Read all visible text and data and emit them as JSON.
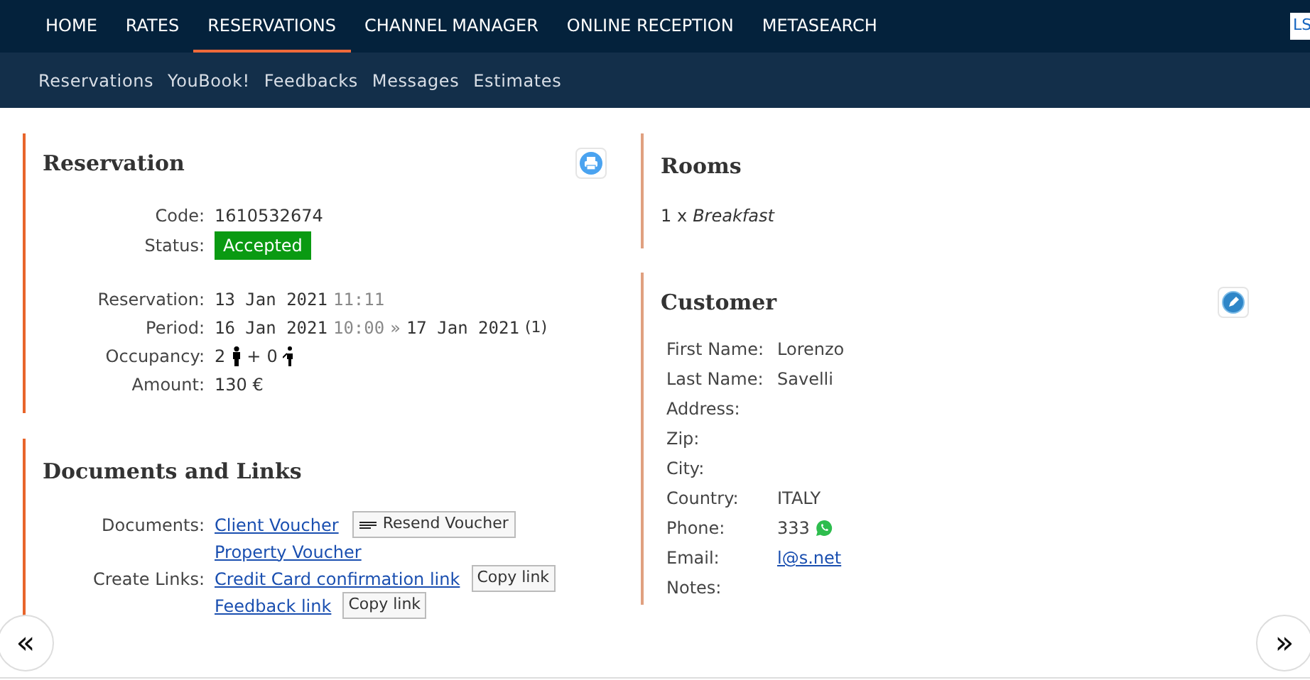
{
  "top_nav": [
    {
      "label": "HOME",
      "selected": false
    },
    {
      "label": "RATES",
      "selected": false
    },
    {
      "label": "RESERVATIONS",
      "selected": true
    },
    {
      "label": "CHANNEL MANAGER",
      "selected": false
    },
    {
      "label": "ONLINE RECEPTION",
      "selected": false
    },
    {
      "label": "METASEARCH",
      "selected": false
    }
  ],
  "user_button": "LS",
  "sub_nav": [
    "Reservations",
    "YouBook!",
    "Feedbacks",
    "Messages",
    "Estimates"
  ],
  "reservation": {
    "title": "Reservation",
    "code_label": "Code:",
    "code": "1610532674",
    "status_label": "Status:",
    "status": "Accepted",
    "reservation_label": "Reservation:",
    "reservation_date": "13 Jan 2021",
    "reservation_time": "11:11",
    "period_label": "Period:",
    "period_start": "16 Jan 2021",
    "period_time": "10:00",
    "period_sep": "»",
    "period_end": "17 Jan 2021",
    "nights": "(1)",
    "occupancy_label": "Occupancy:",
    "adults": "2",
    "plus": "+",
    "children": "0",
    "amount_label": "Amount:",
    "amount": "130 €"
  },
  "documents": {
    "title": "Documents and Links",
    "documents_label": "Documents:",
    "client_voucher": "Client Voucher",
    "resend_button": "Resend Voucher",
    "property_voucher": "Property Voucher",
    "links_label": "Create Links:",
    "links": [
      {
        "label": "Credit Card confirmation link",
        "button": "Copy link"
      },
      {
        "label": "Feedback link",
        "button": "Copy link"
      }
    ]
  },
  "rooms": {
    "title": "Rooms",
    "count": "1 x",
    "name": "Breakfast"
  },
  "customer": {
    "title": "Customer",
    "fields": [
      {
        "label": "First Name:",
        "value": "Lorenzo"
      },
      {
        "label": "Last Name:",
        "value": "Savelli"
      },
      {
        "label": "Address:"
      },
      {
        "label": "Zip:"
      },
      {
        "label": "City:"
      },
      {
        "label": "Country:",
        "value": "ITALY"
      },
      {
        "label": "Phone:",
        "value": "333",
        "kind": "phone"
      },
      {
        "label": "Email:",
        "value": "l@s.net",
        "kind": "email"
      },
      {
        "label": "Notes:"
      }
    ]
  },
  "pager": {
    "prev": "«",
    "next": "»"
  }
}
